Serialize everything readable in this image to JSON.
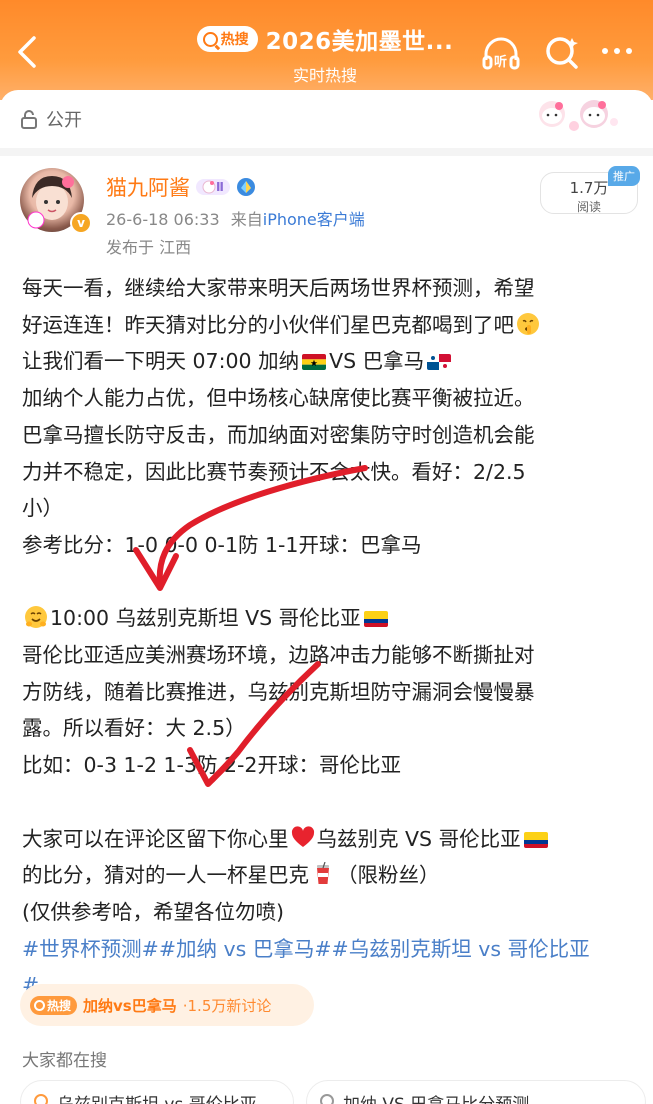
{
  "header": {
    "hot_badge": "热搜",
    "title": "2026美加墨世...",
    "subtitle": "实时热搜"
  },
  "visibility": {
    "label": "公开"
  },
  "post": {
    "username": "猫九阿酱",
    "level_badge": "Ⅱ",
    "timestamp": "26-6-18 06:33",
    "source_prefix": "来自",
    "device": "iPhone客户端",
    "location": "发布于 江西",
    "reads_count": "1.7万",
    "reads_label": "阅读",
    "promo_tag": "推广",
    "lines": {
      "l1": "每天一看，继续给大家带来明天后两场世界杯预测，希望",
      "l2": "好运连连！昨天猜对比分的小伙伴们星巴克都喝到了吧",
      "l3_a": "让我们看一下明天 07:00 加纳",
      "l3_b": "VS 巴拿马",
      "l4": "加纳个人能力占优，但中场核心缺席使比赛平衡被拉近。",
      "l5": "巴拿马擅长防守反击，而加纳面对密集防守时创造机会能",
      "l6": "力并不稳定，因此比赛节奏预计不会太快。看好：2/2.5",
      "l7": "小）",
      "l8": "参考比分：1-0 0-0 0-1防 1-1开球：巴拿马",
      "l10_a": "10:00 乌兹别克斯坦 VS 哥伦比亚",
      "l11": "哥伦比亚适应美洲赛场环境，边路冲击力能够不断撕扯对",
      "l12": "方防线，随着比赛推进，乌兹别克斯坦防守漏洞会慢慢暴",
      "l13": "露。所以看好：大 2.5）",
      "l14": "比如：0-3 1-2 1-3防 2-2开球：哥伦比亚",
      "l16_a": "大家可以在评论区留下你心里",
      "l16_b": "乌兹别克 VS 哥伦比亚",
      "l17_a": "的比分，猜对的一人一杯星巴克",
      "l17_b": "（限粉丝）",
      "l18": "(仅供参考哈，希望各位勿喷)",
      "l19": "#世界杯预测##加纳 vs 巴拿马##乌兹别克斯坦 vs 哥伦比亚",
      "l20": "#"
    }
  },
  "hot_topic": {
    "badge": "热搜",
    "text": "加纳vs巴拿马",
    "count": "·1.5万新讨论"
  },
  "search_section": {
    "heading": "大家都在搜",
    "chips": [
      "乌兹别克斯坦 vs 哥伦比亚",
      "加纳 VS 巴拿马比分预测"
    ]
  },
  "colors": {
    "accent": "#ff7a14",
    "topic": "#4a7fc8",
    "arrow": "#e01e2a"
  },
  "icons": [
    "back-arrow-icon",
    "listen-icon",
    "search-icon",
    "more-icon",
    "lock-open-icon",
    "verified-icon",
    "ghana-flag-icon",
    "panama-flag-icon",
    "colombia-flag-icon",
    "heart-icon",
    "cup-icon"
  ]
}
